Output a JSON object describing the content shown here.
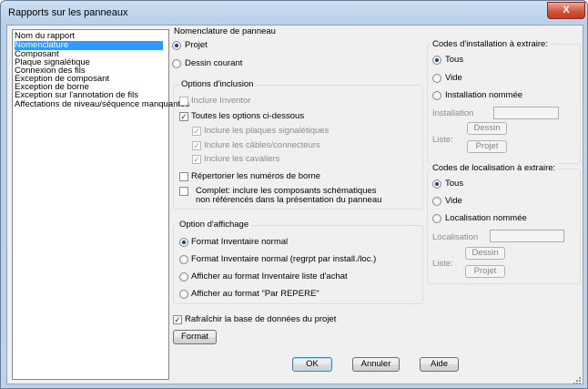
{
  "window": {
    "title": "Rapports sur les panneaux",
    "close_label": "X"
  },
  "report_list": {
    "header": "Nom du rapport",
    "items": [
      "Nomenclature",
      "Composant",
      "Plaque signalétique",
      "Connexion des fils",
      "Exception de composant",
      "Exception de borne",
      "Exception sur l'annotation de fils",
      "Affectations de niveau/séquence manquantes"
    ],
    "selected": "Nomenclature"
  },
  "nomenclature": {
    "title": "Nomenclature de panneau",
    "projet": "Projet",
    "dessin_courant": "Dessin courant"
  },
  "inclusion": {
    "title": "Options d'inclusion",
    "inclure_inventor": "Inclure Inventor",
    "toutes_options": "Toutes les options ci-dessous",
    "plaques": "Inclure les plaques signalétiques",
    "cables": "Inclure les câbles/connecteurs",
    "cavaliers": "Inclure les cavaliers",
    "numeros_borne": "Répertorier les numéros de borne",
    "complet_line1": "Complet: inclure les composants schématiques",
    "complet_line2": "non référencés dans la présentation du panneau",
    "check_mark": "✓"
  },
  "affichage": {
    "title": "Option d'affichage",
    "opt1": "Format Inventaire normal",
    "opt2": "Format Inventaire normal (regrpt par install./loc.)",
    "opt3": "Afficher au format Inventaire liste d'achat",
    "opt4": "Afficher au format \"Par REPERE\""
  },
  "installation": {
    "title": "Codes d'installation à extraire:",
    "tous": "Tous",
    "vide": "Vide",
    "nommee": "Installation nommée",
    "field_label": "Installation",
    "field_value": "",
    "liste_label": "Liste:",
    "dessin_btn": "Dessin",
    "projet_btn": "Projet"
  },
  "localisation": {
    "title": "Codes de localisation à extraire:",
    "tous": "Tous",
    "vide": "Vide",
    "nommee": "Localisation nommée",
    "field_label": "Localisation",
    "field_value": "",
    "liste_label": "Liste:",
    "dessin_btn": "Dessin",
    "projet_btn": "Projet"
  },
  "bottom": {
    "rafraichir": "Rafraîchir la base de données du projet",
    "format": "Format",
    "ok": "OK",
    "annuler": "Annuler",
    "aide": "Aide"
  }
}
